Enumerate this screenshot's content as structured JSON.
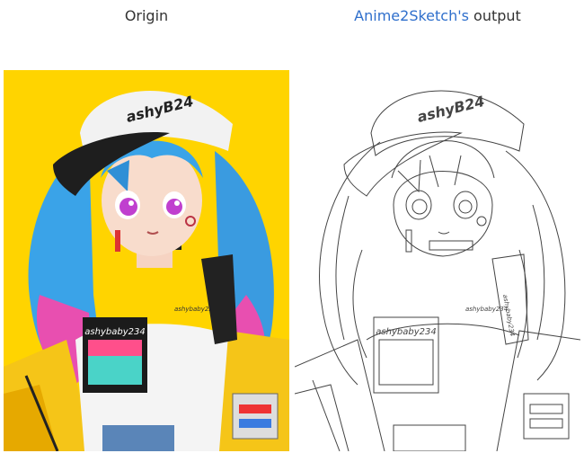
{
  "captions": {
    "origin": "Origin",
    "output_link": "Anime2Sketch's",
    "output_suffix": " output"
  },
  "artwork_text": {
    "cap": "ashyB24",
    "shirt": "ashybaby234",
    "small": "ashybaby234",
    "strap": "ashybaby234"
  },
  "colors": {
    "origin_background": "#FFD400",
    "link": "#2f6fcc",
    "sketch_line": "#444444"
  }
}
